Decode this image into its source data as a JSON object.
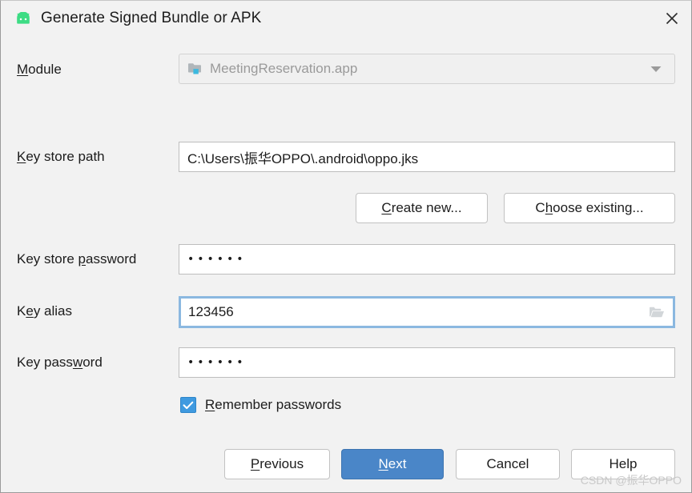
{
  "window": {
    "title": "Generate Signed Bundle or APK",
    "app_icon": "android-robot-icon",
    "close_icon": "close-icon"
  },
  "form": {
    "module": {
      "label_pre": "M",
      "label_post": "odule",
      "icon": "module-folder-icon",
      "value": "MeetingReservation.app",
      "arrow_icon": "chevron-down-icon",
      "disabled": true
    },
    "key_store_path": {
      "label_pre": "K",
      "label_post": "ey store path",
      "value": "C:\\Users\\振华OPPO\\.android\\oppo.jks"
    },
    "create_new_button": {
      "label_pre": "C",
      "label_post": "reate new..."
    },
    "choose_existing_button": {
      "label_pre_plain": "C",
      "label_mn": "h",
      "label_post": "oose existing..."
    },
    "key_store_password": {
      "label_pre_plain": "Key store ",
      "label_mn": "p",
      "label_post": "assword",
      "value": "••••••"
    },
    "key_alias": {
      "label_pre_plain": "K",
      "label_mn": "e",
      "label_post": "y alias",
      "value": "123456",
      "focused": true,
      "browse_icon": "folder-open-icon"
    },
    "key_password": {
      "label_pre_plain": "Key pass",
      "label_mn": "w",
      "label_post": "ord",
      "value": "••••••"
    },
    "remember_passwords": {
      "label_pre": "R",
      "label_post": "emember passwords",
      "checked": true,
      "check_icon": "checkmark-icon"
    }
  },
  "footer": {
    "previous_button": {
      "label_pre": "P",
      "label_post": "revious"
    },
    "next_button": {
      "label_pre": "N",
      "label_post": "ext"
    },
    "cancel_button": {
      "label": "Cancel"
    },
    "help_button": {
      "label": "Help"
    }
  },
  "watermark": {
    "text": "CSDN @振华OPPO"
  },
  "colors": {
    "accent": "#4a86c8",
    "focus_border": "#8bb8e0",
    "checkbox": "#3f9ae0",
    "android_green": "#3ddc84",
    "background": "#f2f2f2"
  }
}
